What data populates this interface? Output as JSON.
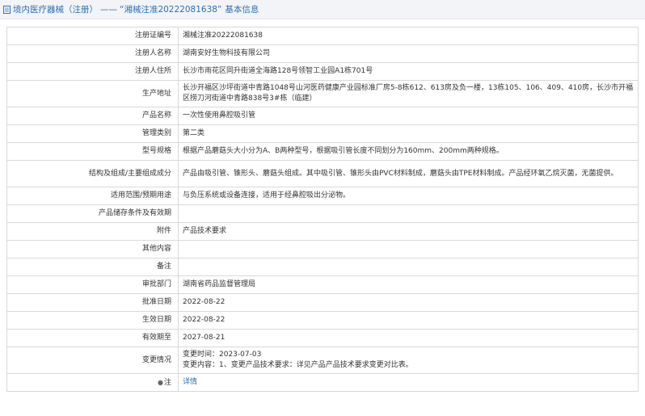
{
  "header": {
    "category": "境内医疗器械（注册）",
    "separator": "——",
    "title_quoted": "“湘械注准20222081638”",
    "title_suffix": "基本信息"
  },
  "rows": [
    {
      "label": "注册证编号",
      "value": "湘械注准20222081638"
    },
    {
      "label": "注册人名称",
      "value": "湖南安好生物科技有限公司"
    },
    {
      "label": "注册人住所",
      "value": "长沙市雨花区同升街道全海路128号领智工业园A1栋701号"
    },
    {
      "label": "生产地址",
      "value": "长沙开福区沙坪街道中青路1048号山河医药健康产业园标准厂房5-8栋612、613房及负一楼，13栋105、106、409、410房，长沙市开福区捞刀河街道中青路838号3#栋（临建）"
    },
    {
      "label": "产品名称",
      "value": "一次性使用鼻腔吸引管"
    },
    {
      "label": "管理类别",
      "value": "第二类"
    },
    {
      "label": "型号规格",
      "value": "根据产品蘑菇头大小分为A、B两种型号，根据吸引管长度不同划分为160mm、200mm两种规格。"
    },
    {
      "label": "结构及组成/主要组成成分",
      "value": "产品由吸引管、锥形头、蘑菇头组成。其中吸引管、锥形头由PVC材料制成，蘑菇头由TPE材料制成。产品经环氧乙烷灭菌，无菌提供。"
    },
    {
      "label": "适用范围/预期用途",
      "value": "与负压系统或设备连接，适用于经鼻腔吸出分泌物。"
    },
    {
      "label": "产品储存条件及有效期",
      "value": ""
    },
    {
      "label": "附件",
      "value": "产品技术要求"
    },
    {
      "label": "其他内容",
      "value": ""
    },
    {
      "label": "备注",
      "value": ""
    },
    {
      "label": "审批部门",
      "value": "湖南省药品监督管理局"
    },
    {
      "label": "批准日期",
      "value": "2022-08-22"
    },
    {
      "label": "生效日期",
      "value": "2022-08-22"
    },
    {
      "label": "有效期至",
      "value": "2027-08-21"
    }
  ],
  "change": {
    "label": "变更情况",
    "time": "变更时间：2023-07-03",
    "content": "变更内容：1、变更产品技术要求：详见产品产品技术要求变更对比表。"
  },
  "note": {
    "label": "注",
    "link": "详情"
  },
  "colors": {
    "link": "#2d6fb3",
    "border": "#d9d9d9",
    "header_bg": "#f2f4f7"
  }
}
